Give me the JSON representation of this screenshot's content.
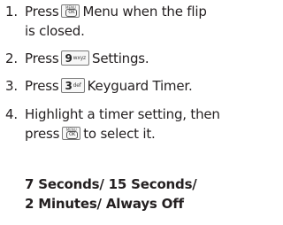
{
  "steps": [
    {
      "num": "1.",
      "line1_after_key": "Menu when the flip",
      "line1_before_key": "Press",
      "line2": "is closed.",
      "key": {
        "label": "MENU",
        "sub": "OK",
        "icon": "ok-key-icon"
      }
    },
    {
      "num": "2.",
      "before_key": "Press",
      "after_key": "Settings.",
      "key": {
        "digit": "9",
        "letters": "wxyz",
        "icon": "key-9-icon"
      }
    },
    {
      "num": "3.",
      "before_key": "Press",
      "after_key": "Keyguard Timer.",
      "key": {
        "digit": "3",
        "letters": "def",
        "icon": "key-3-icon"
      }
    },
    {
      "num": "4.",
      "line1": "Highlight a timer setting, then",
      "line2_before_key": "press",
      "line2_after_key": "to select it.",
      "key": {
        "label": "MENU",
        "sub": "OK",
        "icon": "ok-key-icon"
      }
    }
  ],
  "options": {
    "line1": "7 Seconds/ 15 Seconds/",
    "line2": "2 Minutes/ Always Off"
  }
}
